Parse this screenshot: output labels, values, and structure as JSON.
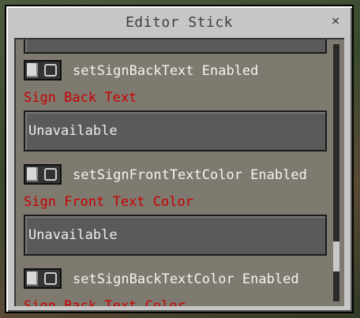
{
  "window": {
    "title": "Editor Stick",
    "close_glyph": "×"
  },
  "rows": {
    "back_text": {
      "toggle_label": "setSignBackText Enabled",
      "section_label": "Sign Back Text",
      "value": "Unavailable"
    },
    "front_text_color": {
      "toggle_label": "setSignFrontTextColor Enabled",
      "section_label": "Sign Front Text Color",
      "value": "Unavailable"
    },
    "back_text_color": {
      "toggle_label": "setSignBackTextColor Enabled",
      "section_label": "Sign Back Text Color"
    }
  },
  "colors": {
    "section_label": "#c80000",
    "panel": "#c6c6c6",
    "field": "#5a5a5a"
  },
  "icons": [
    "close-icon",
    "toggle-switch"
  ]
}
